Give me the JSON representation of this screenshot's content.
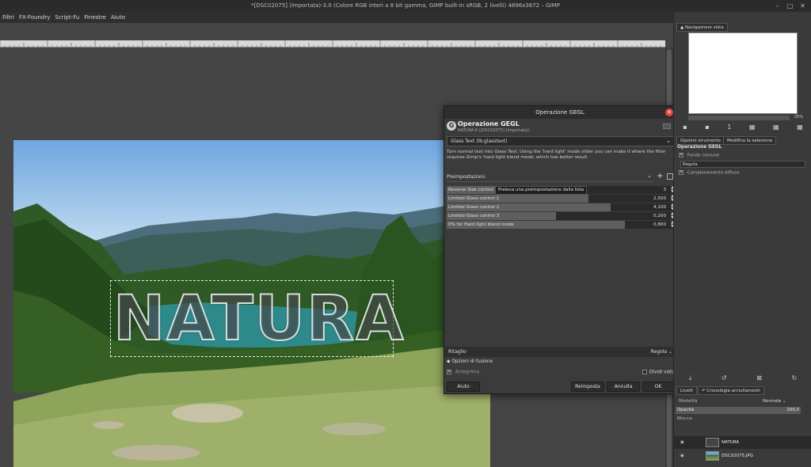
{
  "window": {
    "title": "*[DSC02075] (importata)-3.0 (Colore RGB interi a 8 bit gamma, GIMP built-in sRGB, 2 livelli) 4896x3672 – GIMP",
    "controls": [
      "–",
      "□",
      "✕"
    ]
  },
  "menubar": {
    "items": [
      "Filtri",
      "FX-Foundry",
      "Script-Fu",
      "Finestre",
      "Aiuto"
    ]
  },
  "canvas": {
    "text_layer": "NATURA"
  },
  "dialog": {
    "title": "Operazione GEGL",
    "heading": "Operazione GEGL",
    "subheading": "NATURA-6 ([DSC02075] (importata))",
    "operation": "Glass Text (lb:glasstext)",
    "description": "Turn normal text into Glass Text. Using the 'hard light' mode slider you can make it where the filter requires Gimp's 'hard light blend mode; which has better result.",
    "presets_label": "Preimpostazioni:",
    "tooltip": "Preleva una preimpostazione dalla lista",
    "sliders": [
      {
        "label": "Reverse Size control",
        "value": "3",
        "fill": 0.3
      },
      {
        "label": "Limited Glass control 1",
        "value": "2,500",
        "fill": 0.62
      },
      {
        "label": "Limited Glass control 2",
        "value": "4,100",
        "fill": 0.72
      },
      {
        "label": "Limited Glass control 3",
        "value": "0,200",
        "fill": 0.48
      },
      {
        "label": "0% for Hard light blend mode",
        "value": "0,800",
        "fill": 0.78
      }
    ],
    "clipping": {
      "label": "Ritaglio",
      "value": "Regola"
    },
    "blend_options": "Opzioni di fusione",
    "preview": "Anteprima",
    "split_view": "Dividi vista",
    "buttons": {
      "help": "Aiuto",
      "reset": "Reimposta",
      "cancel": "Annulla",
      "ok": "OK"
    }
  },
  "dock": {
    "navigation_tab": "Navigazione vista",
    "zoom": "25%",
    "tool_options_tab": "Opzioni strumento",
    "selection_tab": "Modifica la selezione",
    "tool_heading": "Operazione GEGL",
    "tool_line1": "Fondo comune",
    "clip_value": "Regola",
    "tool_line2": "Campionamento diffuso",
    "layers_tab": "Livelli",
    "history_tab": "Cronologia annullamenti",
    "mode_label": "Modalità",
    "mode_value": "Normale",
    "opacity_label": "Opacità",
    "opacity_value": "100,0",
    "lock_label": "Blocca:",
    "layers": [
      {
        "name": "NATURA"
      },
      {
        "name": "DSC02075.JPG"
      }
    ]
  },
  "colors": {
    "dialog_bg": "#3b3b3b",
    "close_red": "#e2473b",
    "slider_fill": "#5f5f5f"
  }
}
